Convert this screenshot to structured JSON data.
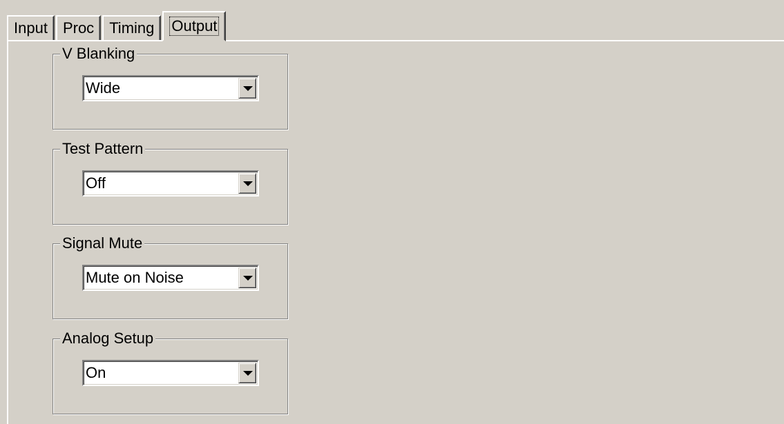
{
  "tabs": [
    {
      "label": "Input"
    },
    {
      "label": "Proc"
    },
    {
      "label": "Timing"
    },
    {
      "label": "Output",
      "active": true
    }
  ],
  "groups": [
    {
      "title": "V Blanking",
      "value": "Wide"
    },
    {
      "title": "Test Pattern",
      "value": "Off"
    },
    {
      "title": "Signal Mute",
      "value": "Mute on Noise"
    },
    {
      "title": "Analog Setup",
      "value": "On"
    }
  ],
  "colors": {
    "face": "#d4d0c8",
    "highlight": "#ffffff",
    "shadow": "#808080",
    "dark_shadow": "#404040",
    "field": "#ffffff"
  },
  "icons": {
    "combo_dropdown": "chevron-down-icon"
  }
}
